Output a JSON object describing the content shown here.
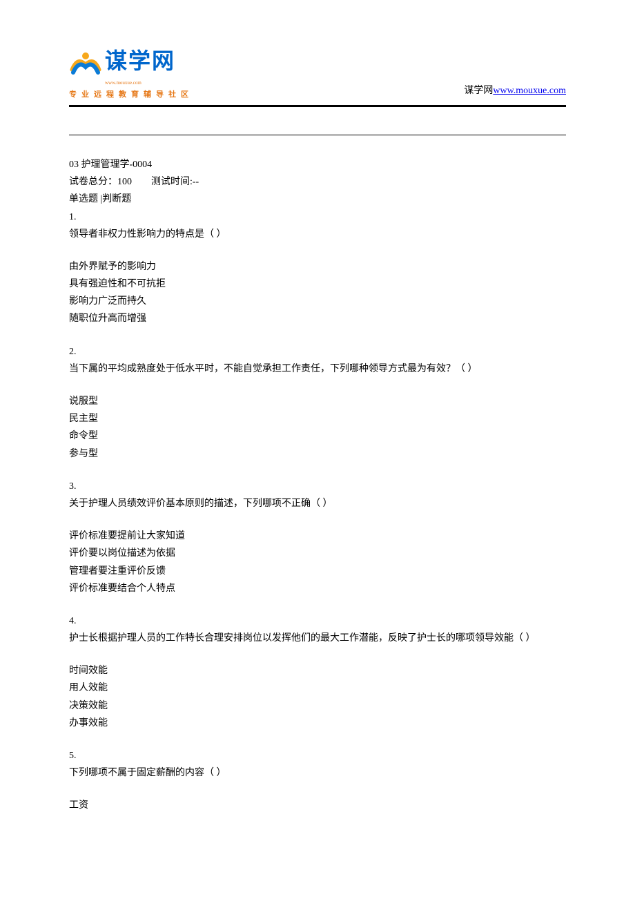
{
  "header": {
    "logo_text": "谋学网",
    "logo_url_small": "www.mouxue.com",
    "logo_sub": "专业远程教育辅导社区",
    "site_label": "谋学网",
    "site_url_text": "www.mouxue.com",
    "site_url": "http://www.mouxue.com"
  },
  "exam": {
    "title": "03 护理管理学-0004",
    "score_label": "试卷总分：100",
    "time_label": "测试时间:--",
    "tabs": "单选题  |判断题"
  },
  "questions": [
    {
      "num": "1.",
      "stem": "领导者非权力性影响力的特点是（ ）",
      "options": [
        "由外界赋予的影响力",
        "具有强迫性和不可抗拒",
        "影响力广泛而持久",
        "随职位升高而增强"
      ]
    },
    {
      "num": "2.",
      "stem": "当下属的平均成熟度处于低水平时，不能自觉承担工作责任，下列哪种领导方式最为有效？（ ）",
      "options": [
        "说服型",
        "民主型",
        "命令型",
        "参与型"
      ]
    },
    {
      "num": "3.",
      "stem": "关于护理人员绩效评价基本原则的描述，下列哪项不正确（ ）",
      "options": [
        "评价标准要提前让大家知道",
        "评价要以岗位描述为依据",
        "管理者要注重评价反馈",
        "评价标准要结合个人特点"
      ]
    },
    {
      "num": "4.",
      "stem": "护士长根据护理人员的工作特长合理安排岗位以发挥他们的最大工作潜能，反映了护士长的哪项领导效能（ ）",
      "options": [
        "时间效能",
        "用人效能",
        "决策效能",
        "办事效能"
      ]
    },
    {
      "num": "5.",
      "stem": "下列哪项不属于固定薪酬的内容（ ）",
      "options": [
        "工资"
      ]
    }
  ]
}
